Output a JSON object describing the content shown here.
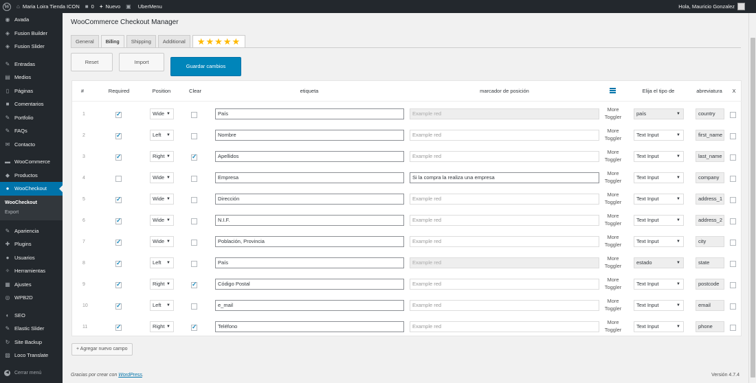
{
  "adminbar": {
    "site_name": "Maria Loira Tienda ICON",
    "comments": "0",
    "new_label": "Nuevo",
    "plugin": "UberMenu",
    "greeting": "Hola, Mauricio Gonzalez"
  },
  "sidebar": {
    "items": [
      {
        "label": "Avada",
        "icon": "avada-icon"
      },
      {
        "label": "Fusion Builder",
        "icon": "fusion-icon"
      },
      {
        "label": "Fusion Slider",
        "icon": "fusion-icon"
      },
      {
        "label": "Entradas",
        "icon": "pin-icon"
      },
      {
        "label": "Medios",
        "icon": "media-icon"
      },
      {
        "label": "Páginas",
        "icon": "page-icon"
      },
      {
        "label": "Comentarios",
        "icon": "comment-icon"
      },
      {
        "label": "Portfolio",
        "icon": "pin-icon"
      },
      {
        "label": "FAQs",
        "icon": "pin-icon"
      },
      {
        "label": "Contacto",
        "icon": "mail-icon"
      },
      {
        "label": "WooCommerce",
        "icon": "woo-icon"
      },
      {
        "label": "Productos",
        "icon": "product-icon"
      },
      {
        "label": "WooCheckout",
        "icon": "user-icon"
      },
      {
        "label": "Apariencia",
        "icon": "brush-icon"
      },
      {
        "label": "Plugins",
        "icon": "plug-icon"
      },
      {
        "label": "Usuarios",
        "icon": "user-icon"
      },
      {
        "label": "Herramientas",
        "icon": "wrench-icon"
      },
      {
        "label": "Ajustes",
        "icon": "settings-icon"
      },
      {
        "label": "WPB2D",
        "icon": "box-icon"
      },
      {
        "label": "SEO",
        "icon": "seo-icon"
      },
      {
        "label": "Elastic Slider",
        "icon": "pin-icon"
      },
      {
        "label": "Site Backup",
        "icon": "backup-icon"
      },
      {
        "label": "Loco Translate",
        "icon": "translate-icon"
      }
    ],
    "submenu": [
      "WooCheckout",
      "Export"
    ],
    "collapse": "Cerrar menú"
  },
  "page": {
    "title": "WooCommerce Checkout Manager",
    "tabs": [
      "General",
      "Billing",
      "Shipping",
      "Additional"
    ],
    "stars": "★★★★★",
    "reset": "Reset",
    "import": "Import",
    "save": "Guardar cambios",
    "add_field": "+ Agregar nuevo campo",
    "footer_text": "Gracias por crear con ",
    "footer_link": "WordPress",
    "footer_end": ".",
    "version": "Versión 4.7.4"
  },
  "table": {
    "headers": {
      "num": "#",
      "required": "Required",
      "position": "Position",
      "clear": "Clear",
      "label": "etiqueta",
      "placeholder": "marcador de posición",
      "type": "Elija el tipo de",
      "abbr": "abreviatura",
      "x": "X"
    },
    "toggler": [
      "More",
      "Toggler"
    ],
    "rows": [
      {
        "n": "1",
        "req": true,
        "pos": "Wide",
        "clear": false,
        "label": "País",
        "ph": "Example red",
        "ph_state": "disabled",
        "type": "país",
        "type_grey": true,
        "abbr": "country"
      },
      {
        "n": "2",
        "req": true,
        "pos": "Left",
        "clear": false,
        "label": "Nombre",
        "ph": "Example red",
        "ph_state": "placeholder",
        "type": "Text Input",
        "type_grey": false,
        "abbr": "first_name"
      },
      {
        "n": "3",
        "req": true,
        "pos": "Right",
        "clear": true,
        "label": "Apellidos",
        "ph": "Example red",
        "ph_state": "placeholder",
        "type": "Text Input",
        "type_grey": false,
        "abbr": "last_name"
      },
      {
        "n": "4",
        "req": false,
        "pos": "Wide",
        "clear": false,
        "label": "Empresa",
        "ph": "Si la compra la realiza una empresa",
        "ph_state": "value",
        "type": "Text Input",
        "type_grey": false,
        "abbr": "company"
      },
      {
        "n": "5",
        "req": true,
        "pos": "Wide",
        "clear": false,
        "label": "Dirección",
        "ph": "Example red",
        "ph_state": "placeholder",
        "type": "Text Input",
        "type_grey": false,
        "abbr": "address_1"
      },
      {
        "n": "6",
        "req": true,
        "pos": "Wide",
        "clear": false,
        "label": "N.I.F.",
        "ph": "Example red",
        "ph_state": "placeholder",
        "type": "Text Input",
        "type_grey": false,
        "abbr": "address_2"
      },
      {
        "n": "7",
        "req": true,
        "pos": "Wide",
        "clear": false,
        "label": "Población, Provincia",
        "ph": "Example red",
        "ph_state": "placeholder",
        "type": "Text Input",
        "type_grey": false,
        "abbr": "city"
      },
      {
        "n": "8",
        "req": true,
        "pos": "Left",
        "clear": false,
        "label": "País",
        "ph": "Example red",
        "ph_state": "disabled",
        "type": "estado",
        "type_grey": true,
        "abbr": "state"
      },
      {
        "n": "9",
        "req": true,
        "pos": "Right",
        "clear": true,
        "label": "Código Postal",
        "ph": "Example red",
        "ph_state": "placeholder",
        "type": "Text Input",
        "type_grey": false,
        "abbr": "postcode"
      },
      {
        "n": "10",
        "req": true,
        "pos": "Left",
        "clear": false,
        "label": "e_mail",
        "ph": "Example red",
        "ph_state": "placeholder",
        "type": "Text Input",
        "type_grey": false,
        "abbr": "email"
      },
      {
        "n": "11",
        "req": true,
        "pos": "Right",
        "clear": true,
        "label": "Teléfono",
        "ph": "Example red",
        "ph_state": "placeholder",
        "type": "Text Input",
        "type_grey": false,
        "abbr": "phone"
      }
    ]
  },
  "colors": {
    "accent": "#0073aa",
    "primary_button": "#0085ba",
    "sidebar": "#23282d",
    "stars": "#ffb900"
  }
}
